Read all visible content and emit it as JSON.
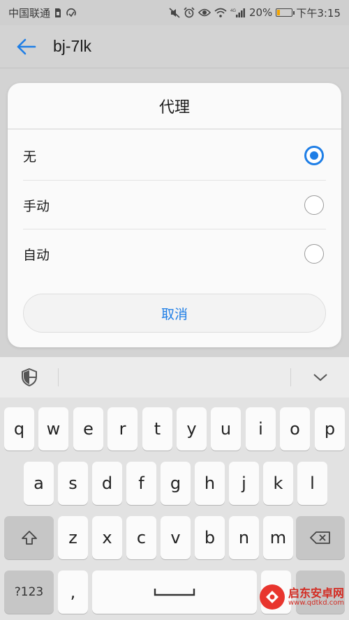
{
  "status_bar": {
    "carrier": "中国联通",
    "battery_percent": "20%",
    "battery_level": 0.2,
    "time": "下午3:15",
    "signal_label": "4G",
    "icons": [
      "sim-icon",
      "sync-icon",
      "mute-icon",
      "alarm-icon",
      "eye-icon",
      "wifi-icon",
      "signal-icon",
      "battery-icon"
    ]
  },
  "app_bar": {
    "title": "bj-7lk",
    "back_icon": "arrow-left-icon"
  },
  "dialog": {
    "title": "代理",
    "options": [
      {
        "label": "无",
        "selected": true
      },
      {
        "label": "手动",
        "selected": false
      },
      {
        "label": "自动",
        "selected": false
      }
    ],
    "cancel_label": "取消"
  },
  "keyboard": {
    "toolbar_icons": [
      "shield-icon",
      "chevron-down-icon"
    ],
    "row1": [
      "q",
      "w",
      "e",
      "r",
      "t",
      "y",
      "u",
      "i",
      "o",
      "p"
    ],
    "row2": [
      "a",
      "s",
      "d",
      "f",
      "g",
      "h",
      "j",
      "k",
      "l"
    ],
    "row3": [
      "z",
      "x",
      "c",
      "v",
      "b",
      "n",
      "m"
    ],
    "symbols_label": "?123",
    "comma_label": ",",
    "shift_icon": "shift-icon",
    "backspace_icon": "backspace-icon",
    "space_icon": "space-bar-icon"
  },
  "watermark": {
    "main": "启东安卓网",
    "sub": "www.qdtkd.com"
  },
  "colors": {
    "accent": "#1e7ee6",
    "background": "#d3d3d3",
    "dialog": "#fafafa",
    "battery": "#f2a300"
  }
}
